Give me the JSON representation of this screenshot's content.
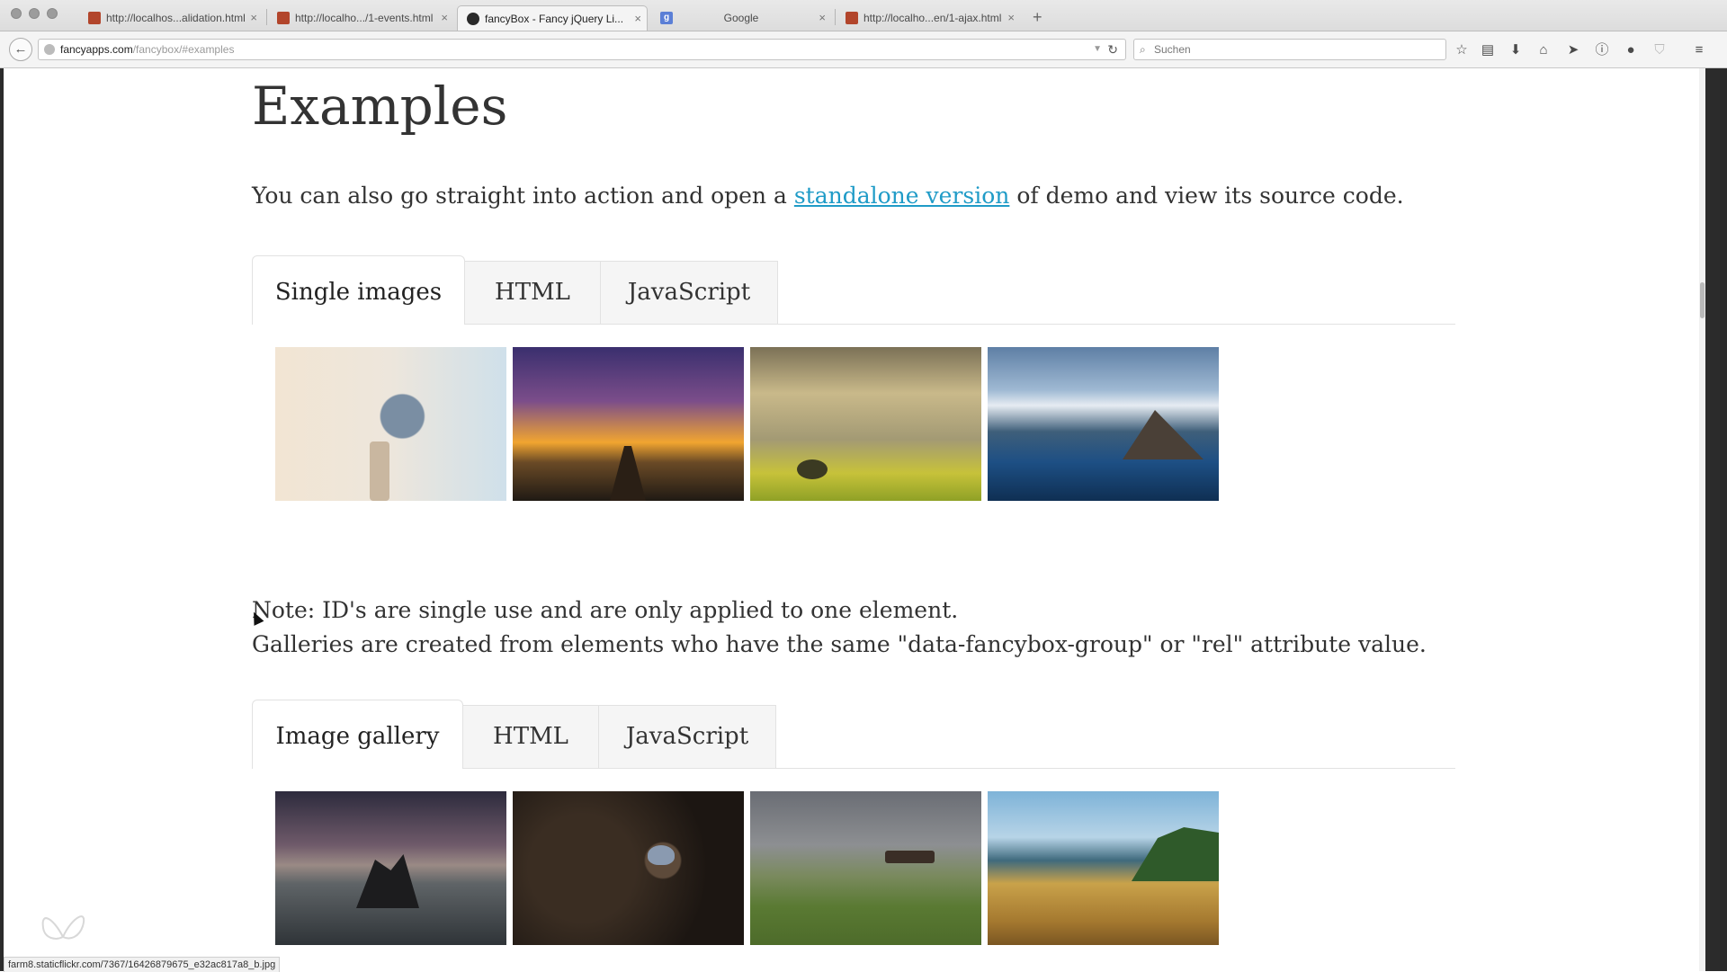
{
  "browser": {
    "tabs": [
      {
        "title": "http://localhos...alidation.html",
        "favicon": "webstorm-icon",
        "active": false
      },
      {
        "title": "http://localho.../1-events.html",
        "favicon": "webstorm-icon",
        "active": false
      },
      {
        "title": "fancyBox - Fancy jQuery Li...",
        "favicon": "fancybox-icon",
        "active": true
      },
      {
        "title": "Google",
        "favicon": "google-icon",
        "active": false
      },
      {
        "title": "http://localho...en/1-ajax.html",
        "favicon": "webstorm-icon",
        "active": false
      }
    ],
    "url_host": "fancyapps.com",
    "url_path": "/fancybox/#examples",
    "search_placeholder": "Suchen",
    "status_url": "farm8.staticflickr.com/7367/16426879675_e32ac817a8_b.jpg"
  },
  "page": {
    "title": "Examples",
    "intro_before": "You can also go straight into action and open a ",
    "intro_link": "standalone version",
    "intro_after": " of demo and view its source code.",
    "section1_tabs": [
      "Single images",
      "HTML",
      "JavaScript"
    ],
    "section1_images": [
      "bird",
      "pier-sunset",
      "tree-field",
      "lofoten-island"
    ],
    "note_line1": "Note: ID's are single use and are only applied to one element.",
    "note_line2": "Galleries are created from elements who have the same \"data-fancybox-group\" or \"rel\" attribute value.",
    "section2_tabs": [
      "Image gallery",
      "HTML",
      "JavaScript"
    ],
    "section2_images": [
      "sea-rocks",
      "butterfly",
      "horses-meadow",
      "stream-shore"
    ]
  },
  "colors": {
    "link": "#1f9bc7",
    "text": "#333333"
  }
}
